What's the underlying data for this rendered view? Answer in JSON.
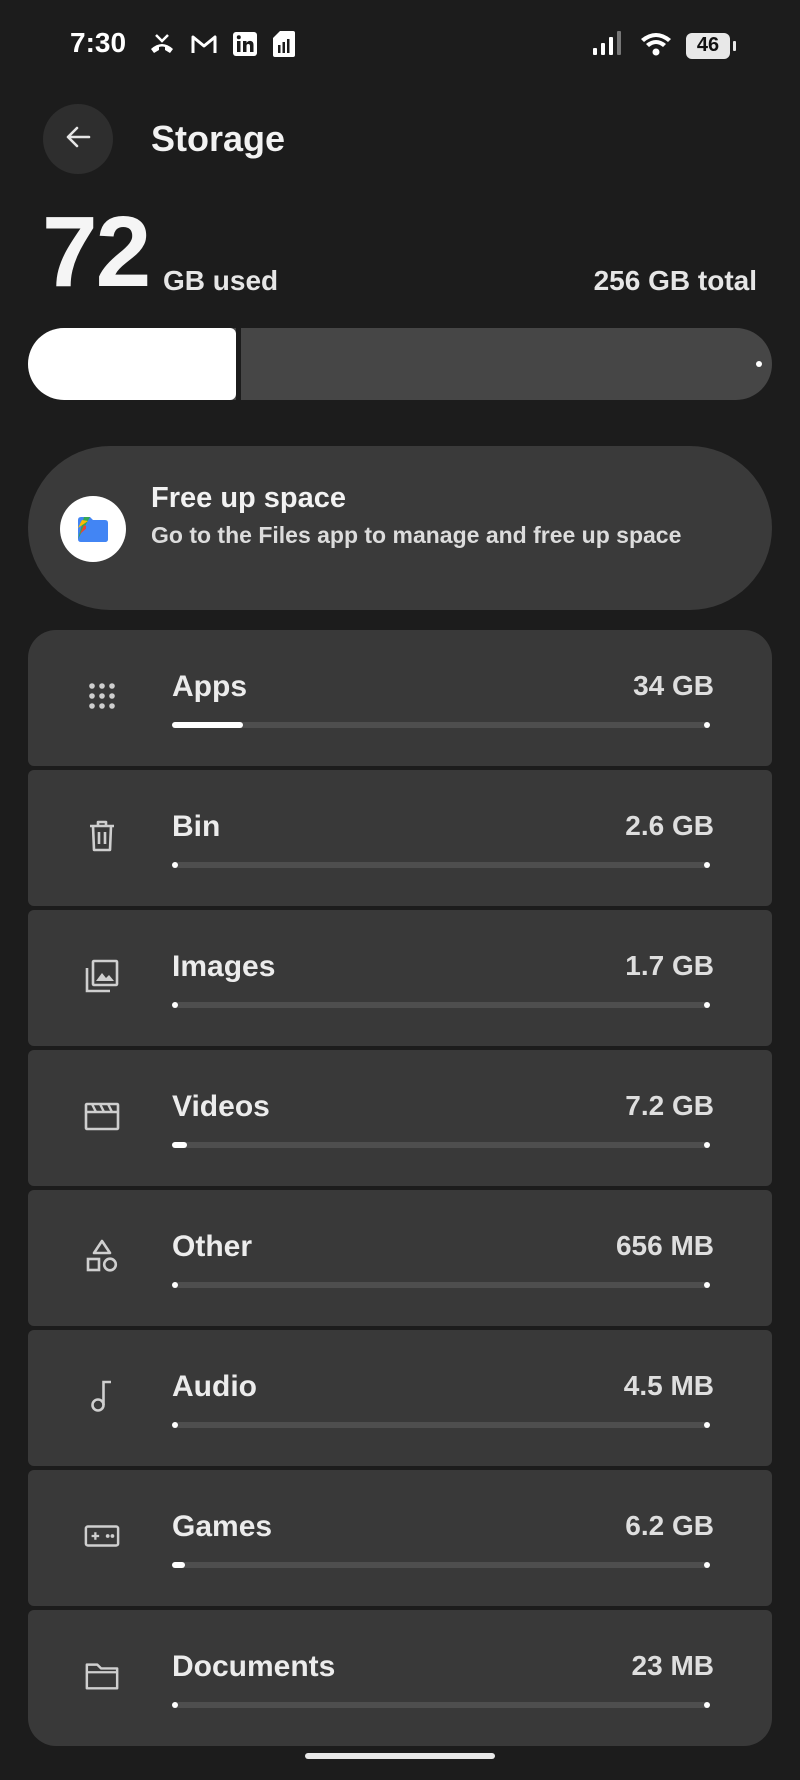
{
  "status": {
    "time": "7:30",
    "left_icons": [
      "missed-call-icon",
      "gmail-icon",
      "linkedin-icon",
      "sim-icon"
    ],
    "right_icons": [
      "signal-icon",
      "wifi-icon"
    ],
    "battery": "46"
  },
  "header": {
    "title": "Storage"
  },
  "summary": {
    "used_value": "72",
    "used_label": "GB used",
    "total_label": "256 GB total",
    "used_fraction": 0.28
  },
  "free_up": {
    "title": "Free up space",
    "subtitle": "Go to the Files app to manage and free up space"
  },
  "categories": [
    {
      "label": "Apps",
      "size": "34 GB",
      "icon": "apps-grid-icon",
      "fraction": 0.133
    },
    {
      "label": "Bin",
      "size": "2.6 GB",
      "icon": "trash-icon",
      "fraction": 0.01
    },
    {
      "label": "Images",
      "size": "1.7 GB",
      "icon": "images-icon",
      "fraction": 0.007
    },
    {
      "label": "Videos",
      "size": "7.2 GB",
      "icon": "video-clapper-icon",
      "fraction": 0.028
    },
    {
      "label": "Other",
      "size": "656 MB",
      "icon": "shapes-icon",
      "fraction": 0.003
    },
    {
      "label": "Audio",
      "size": "4.5 MB",
      "icon": "music-note-icon",
      "fraction": 0.0
    },
    {
      "label": "Games",
      "size": "6.2 GB",
      "icon": "gamepad-icon",
      "fraction": 0.024
    },
    {
      "label": "Documents",
      "size": "23 MB",
      "icon": "folder-icon",
      "fraction": 0.0
    }
  ]
}
